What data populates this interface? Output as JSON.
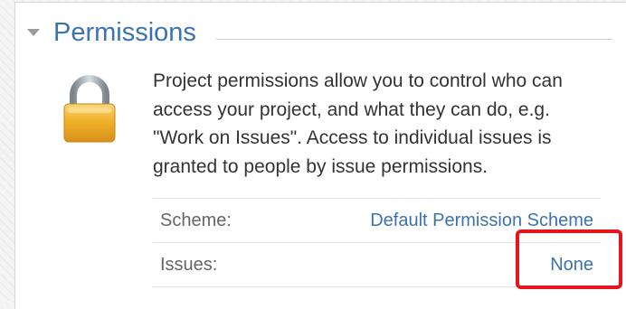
{
  "section": {
    "title": "Permissions",
    "collapse_icon": "chevron-down-icon",
    "lock_icon": "padlock-icon"
  },
  "description": "Project permissions allow you to control who can access your project, and what they can do, e.g. \"Work on Issues\". Access to individual issues is granted to people by issue permissions.",
  "details": [
    {
      "label": "Scheme:",
      "value": "Default Permission Scheme"
    },
    {
      "label": "Issues:",
      "value": "None"
    }
  ],
  "colors": {
    "link": "#3b73af",
    "highlight": "#e8131b",
    "lock_gold": "#f0b129",
    "lock_shackle": "#9aa3ab"
  }
}
